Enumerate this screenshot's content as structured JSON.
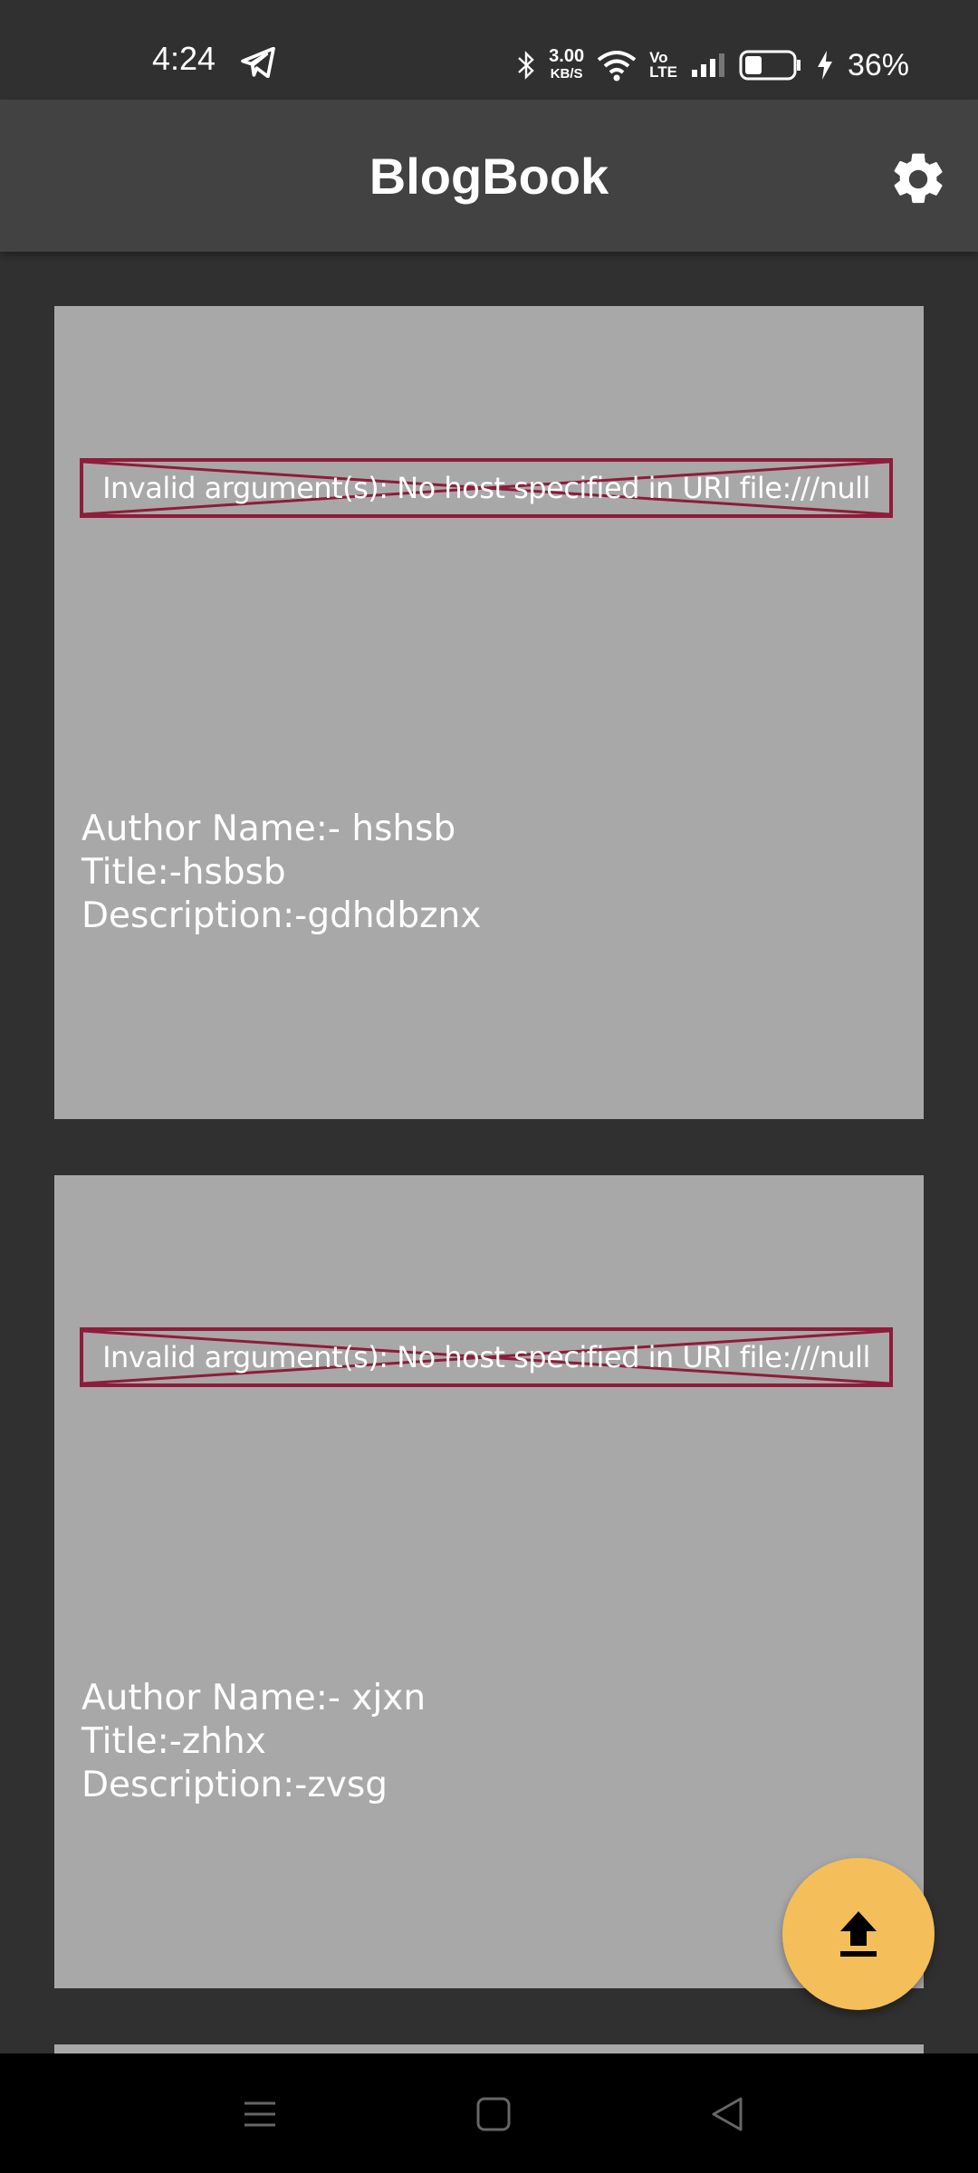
{
  "status_bar": {
    "time": "4:24",
    "speed_value": "3.00",
    "speed_unit": "KB/S",
    "volte_top": "Vo",
    "volte_bottom": "LTE",
    "battery": "36%"
  },
  "app_bar": {
    "title": "BlogBook",
    "settings_icon": "gear-icon"
  },
  "posts": [
    {
      "image_error": "Invalid argument(s): No host specified in URI file:///null",
      "author": "Author Name:- hshsb",
      "title": "Title:-hsbsb",
      "description": "Description:-gdhdbznx"
    },
    {
      "image_error": "Invalid argument(s): No host specified in URI file:///null",
      "author": "Author Name:- xjxn",
      "title": "Title:-zhhx",
      "description": "Description:-zvsg"
    }
  ],
  "fab": {
    "icon": "upload-icon"
  },
  "colors": {
    "background": "#303030",
    "app_bar": "#424242",
    "card": "#a8a8a8",
    "error_border": "#8e1c3a",
    "fab": "#f4bf5a"
  },
  "nav_bar": {
    "icons": [
      "menu-icon",
      "home-icon",
      "back-icon"
    ]
  }
}
